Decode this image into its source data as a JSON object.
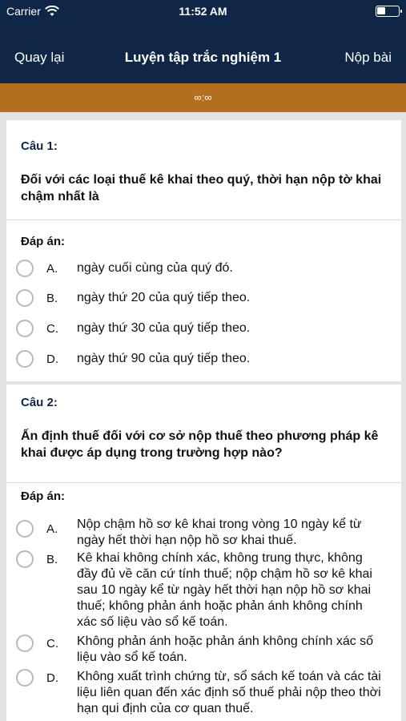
{
  "status_bar": {
    "carrier": "Carrier",
    "time": "11:52 AM",
    "icons": [
      "wifi-icon",
      "battery-icon"
    ]
  },
  "nav": {
    "back_label": "Quay lại",
    "title": "Luyện tập trắc nghiệm 1",
    "submit_label": "Nộp bài"
  },
  "timer": "∞:∞",
  "answer_heading": "Đáp án:",
  "questions": [
    {
      "label": "Câu 1:",
      "text": "Đối với các loại thuế kê khai theo quý, thời hạn nộp tờ khai chậm nhất là",
      "options": [
        {
          "letter": "A.",
          "text": "ngày cuối cùng của quý đó."
        },
        {
          "letter": "B.",
          "text": "ngày thứ 20 của quý tiếp theo."
        },
        {
          "letter": "C.",
          "text": "ngày thứ 30 của quý tiếp theo."
        },
        {
          "letter": "D.",
          "text": "ngày thứ 90 của quý tiếp theo."
        }
      ]
    },
    {
      "label": "Câu 2:",
      "text": "Ấn định thuế đối với cơ sở nộp thuế theo phương pháp kê khai được áp dụng trong trường hợp nào?",
      "options": [
        {
          "letter": "A.",
          "text": "Nộp chậm hồ sơ kê khai trong vòng 10 ngày kể từ ngày hết thời hạn nộp hồ sơ khai thuế."
        },
        {
          "letter": "B.",
          "text": "Kê khai không chính xác, không trung thực, không đầy đủ về căn cứ tính thuế; nộp chậm hồ sơ kê khai sau 10 ngày kể từ ngày hết thời hạn nộp hồ sơ khai thuế; không phản ánh hoặc phản ánh không chính xác số liệu vào sổ kế toán."
        },
        {
          "letter": "C.",
          "text": "Không phản ánh hoặc phản ánh không chính xác số liệu vào sổ kế toán."
        },
        {
          "letter": "D.",
          "text": "Không xuất trình chứng từ, sổ sách kế toán và các tài liệu liên quan đến xác định số thuế phải nộp theo thời hạn qui định của cơ quan thuế."
        }
      ]
    }
  ]
}
